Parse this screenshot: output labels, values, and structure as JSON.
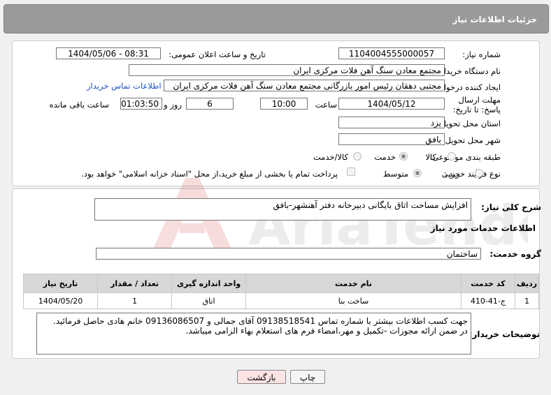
{
  "header": {
    "title": "جزئیات اطلاعات نیاز"
  },
  "fields": {
    "need_number_label": "شماره نیاز:",
    "need_number": "1104004555000057",
    "announce_label": "تاریخ و ساعت اعلان عمومی:",
    "announce_value": "1404/05/06 - 08:31",
    "buyer_org_label": "نام دستگاه خریدار:",
    "buyer_org": "مجتمع معادن سنگ آهن فلات مرکزی ایران",
    "creator_label": "ایجاد کننده درخواست:",
    "creator": "مجتبی  دهقان رئیس امور بازرگانی مجتمع معادن سنگ آهن فلات مرکزی ایران",
    "contact_link": "اطلاعات تماس خریدار",
    "deadline_label": "مهلت ارسال پاسخ: تا تاریخ:",
    "deadline_date": "1404/05/12",
    "time_label": "ساعت",
    "deadline_time": "10:00",
    "days_value": "6",
    "days_label": "روز و",
    "remaining_time": "01:03:50",
    "remaining_label": "ساعت باقی مانده",
    "province_label": "استان محل تحویل:",
    "province": "یزد",
    "city_label": "شهر محل تحویل:",
    "city": "بافق",
    "category_label": "طبقه بندی موضوعی:",
    "category_options": [
      "کالا",
      "خدمت",
      "کالا/خدمت"
    ],
    "category_selected": "خدمت",
    "process_label": "نوع فرآیند خرید :",
    "process_options": [
      "جزیی",
      "متوسط"
    ],
    "process_selected": "متوسط",
    "payment_note": "پرداخت تمام یا بخشی از مبلغ خرید،از محل \"اسناد خزانه اسلامی\" خواهد بود."
  },
  "details": {
    "summary_label": "شرح کلی نیاز:",
    "summary": "افزایش مساحت اتاق بایگانی دبیرخانه دفتر آهنشهر-بافق",
    "services_title": "اطلاعات خدمات مورد نیاز",
    "service_group_label": "گروه خدمت:",
    "service_group": "ساختمان",
    "table": {
      "headers": [
        "ردیف",
        "کد خدمت",
        "نام خدمت",
        "واحد اندازه گیری",
        "تعداد / مقدار",
        "تاریخ نیاز"
      ],
      "rows": [
        [
          "1",
          "ج-41-410",
          "ساخت بنا",
          "اتاق",
          "1",
          "1404/05/20"
        ]
      ]
    },
    "buyer_notes_label": "توضیحات خریدار:",
    "buyer_notes_line1": "جهت کسب اطلاعات بیشتر با شماره تماس 09138518541 آقای جمالی و 09136086507 خانم هادی حاصل فرمائید.",
    "buyer_notes_line2": "در ضمن ارائه مجوزات -تکمیل و مهر،امضاء فرم های استعلام بهاء الزامی میباشد."
  },
  "buttons": {
    "print": "چاپ",
    "back": "بازگشت"
  },
  "colors": {
    "header_bg": "#9a9a9a",
    "link": "#1a52c4",
    "back_button_bg": "#fde4e4"
  }
}
